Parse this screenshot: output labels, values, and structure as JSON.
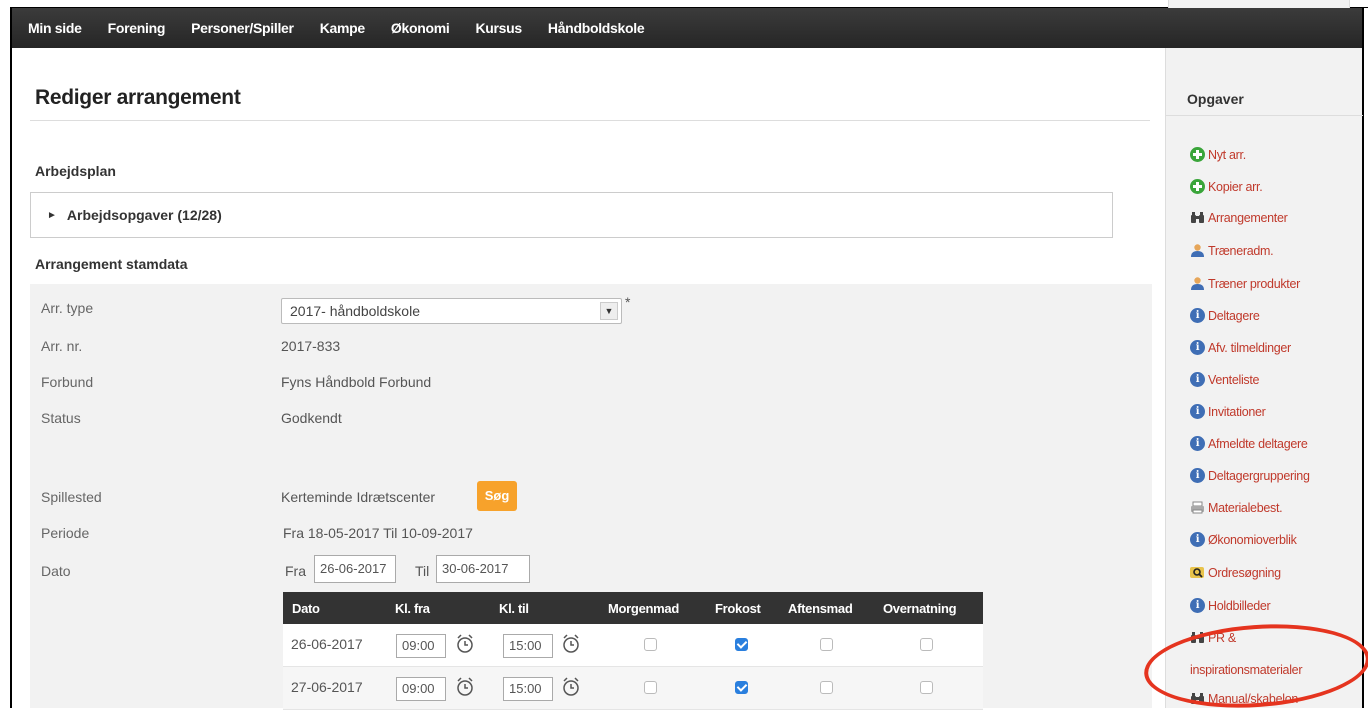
{
  "nav": {
    "items": [
      "Min side",
      "Forening",
      "Personer/Spiller",
      "Kampe",
      "Økonomi",
      "Kursus",
      "Håndboldskole"
    ]
  },
  "page": {
    "title": "Rediger arrangement"
  },
  "workplan": {
    "heading": "Arbejdsplan",
    "accordion_label": "Arbejdsopgaver (12/28)"
  },
  "stamdata": {
    "heading": "Arrangement stamdata",
    "arr_type_label": "Arr. type",
    "arr_type_value": "2017- håndboldskole",
    "required_mark": "*",
    "arr_nr_label": "Arr. nr.",
    "arr_nr_value": "2017-833",
    "forbund_label": "Forbund",
    "forbund_value": "Fyns Håndbold Forbund",
    "status_label": "Status",
    "status_value": "Godkendt",
    "spillested_label": "Spillested",
    "spillested_value": "Kerteminde Idrætscenter",
    "search_button": "Søg",
    "periode_label": "Periode",
    "periode_value": "Fra 18-05-2017 Til 10-09-2017",
    "dato_label": "Dato",
    "dato_from_prefix": "Fra",
    "dato_from_value": "26-06-2017",
    "dato_to_prefix": "Til",
    "dato_to_value": "30-06-2017"
  },
  "schedule": {
    "headers": [
      "Dato",
      "Kl. fra",
      "Kl. til",
      "Morgenmad",
      "Frokost",
      "Aftensmad",
      "Overnatning"
    ],
    "rows": [
      {
        "date": "26-06-2017",
        "from": "09:00",
        "to": "15:00",
        "morgenmad": false,
        "frokost": true,
        "aftensmad": false,
        "overnatning": false
      },
      {
        "date": "27-06-2017",
        "from": "09:00",
        "to": "15:00",
        "morgenmad": false,
        "frokost": true,
        "aftensmad": false,
        "overnatning": false
      }
    ]
  },
  "sidebar": {
    "title": "Opgaver",
    "items": [
      {
        "label": "Nyt arr.",
        "icon": "plus-circle-icon"
      },
      {
        "label": "Kopier arr.",
        "icon": "plus-circle-icon"
      },
      {
        "label": "Arrangementer",
        "icon": "binoculars-icon"
      },
      {
        "label": "Træneradm.",
        "icon": "user-icon"
      },
      {
        "label": "Træner produkter",
        "icon": "user-icon"
      },
      {
        "label": "Deltagere",
        "icon": "info-icon"
      },
      {
        "label": "Afv. tilmeldinger",
        "icon": "info-icon"
      },
      {
        "label": "Venteliste",
        "icon": "info-icon"
      },
      {
        "label": "Invitationer",
        "icon": "info-icon"
      },
      {
        "label": "Afmeldte deltagere",
        "icon": "info-icon"
      },
      {
        "label": "Deltagergruppering",
        "icon": "info-icon"
      },
      {
        "label": "Materialebest.",
        "icon": "printer-icon"
      },
      {
        "label": "Økonomioverblik",
        "icon": "info-icon"
      },
      {
        "label": "Ordresøgning",
        "icon": "search-icon"
      },
      {
        "label": "Holdbilleder",
        "icon": "info-icon"
      },
      {
        "label": "PR &",
        "icon": "binoculars-icon"
      },
      {
        "label": "inspirationsmaterialer",
        "icon": ""
      },
      {
        "label": "Manual/skabelon",
        "icon": "binoculars-icon"
      }
    ]
  },
  "colors": {
    "nav_bg": "#2e2e2e",
    "link": "#c0392b",
    "accent_button": "#f7a22b",
    "highlight_circle": "#e5341f",
    "checkbox_on": "#2a7fde"
  }
}
